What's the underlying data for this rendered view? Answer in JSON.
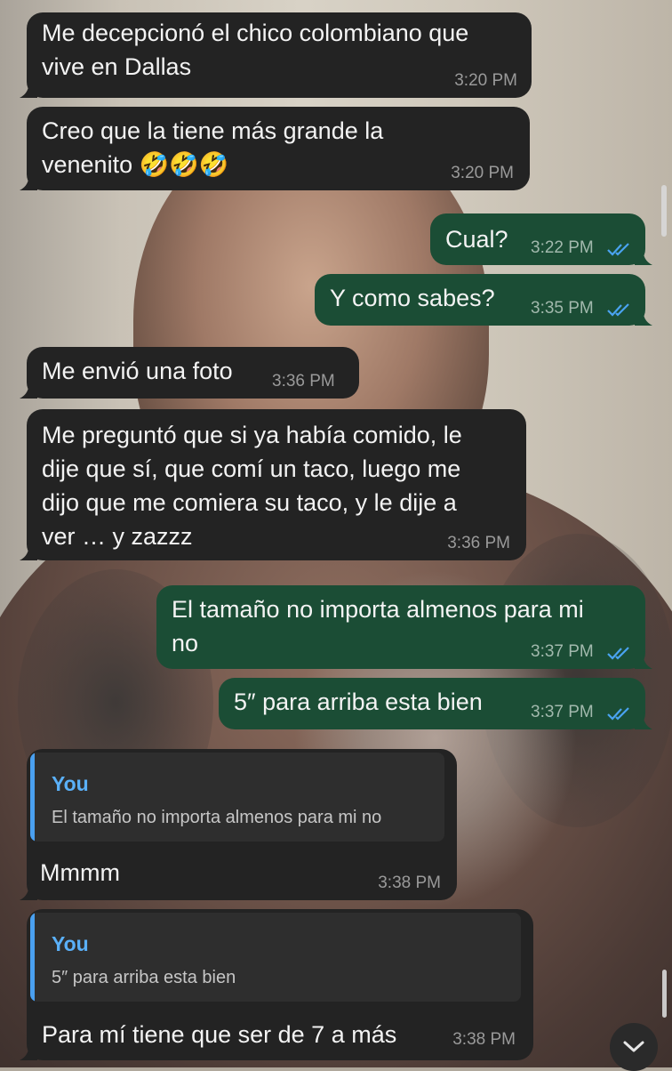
{
  "messages": [
    {
      "text_lines": [
        "Me decepcionó el chico colombiano que",
        "vive en Dallas"
      ],
      "time": "3:20 PM"
    },
    {
      "text_lines": [
        "Creo que la tiene más grande la",
        "venenito 🤣🤣🤣"
      ],
      "time": "3:20 PM"
    },
    {
      "text_lines": [
        "Cual?"
      ],
      "time": "3:22 PM"
    },
    {
      "text_lines": [
        "Y como sabes?"
      ],
      "time": "3:35 PM"
    },
    {
      "text_lines": [
        "Me envió una foto"
      ],
      "time": "3:36 PM"
    },
    {
      "text_lines": [
        "Me preguntó que si ya había comido, le",
        "dije que sí, que comí un taco, luego me",
        "dijo que me comiera su taco, y le dije a",
        "ver  … y  zazzz"
      ],
      "time": "3:36 PM"
    },
    {
      "text_lines": [
        "El tamaño no importa almenos para mi",
        "no"
      ],
      "time": "3:37 PM"
    },
    {
      "text_lines": [
        "5″ para arriba esta bien"
      ],
      "time": "3:37 PM"
    },
    {
      "quote_author": "You",
      "quote_text": "El tamaño no importa almenos para mi no",
      "text_lines": [
        "Mmmm"
      ],
      "time": "3:38 PM"
    },
    {
      "quote_author": "You",
      "quote_text": "5″ para arriba esta bien",
      "text_lines": [
        "Para mí tiene que ser de 7 a más"
      ],
      "time": "3:38 PM"
    }
  ],
  "colors": {
    "incoming_bubble": "#232323",
    "outgoing_bubble": "#1b4d35",
    "read_ticks": "#4aa3f0",
    "quote_accent": "#4aa0f0"
  },
  "icons": {
    "read_receipt": "double-check-icon",
    "scroll_down": "chevron-down-icon"
  }
}
